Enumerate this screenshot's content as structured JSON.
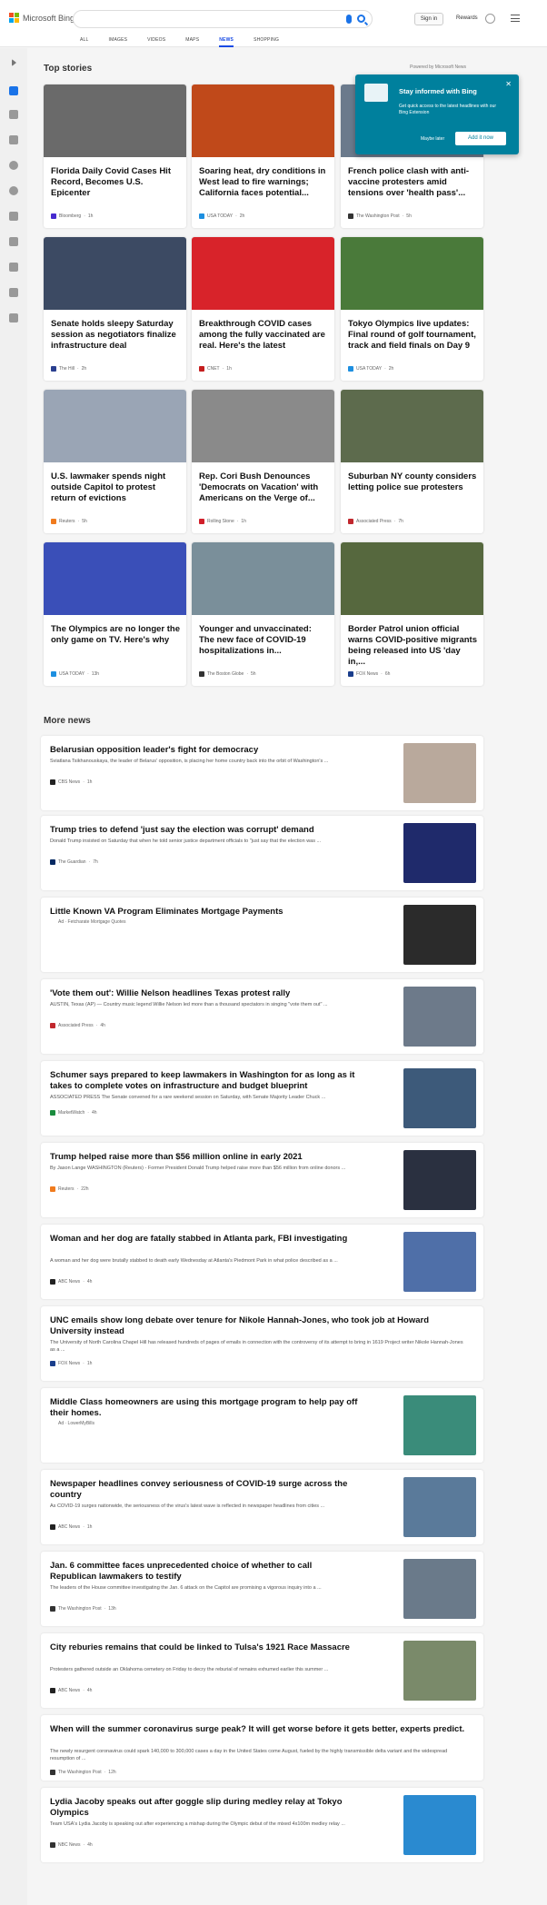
{
  "brand": {
    "name": "Microsoft Bing"
  },
  "header": {
    "signin_label": "Sign in",
    "rewards_label": "Rewards"
  },
  "nav": {
    "tabs": [
      "ALL",
      "IMAGES",
      "VIDEOS",
      "MAPS",
      "NEWS",
      "SHOPPING"
    ],
    "active": "NEWS"
  },
  "section": {
    "top_stories": "Top stories",
    "powered": "Powered by Microsoft News",
    "more_news": "More news"
  },
  "popup": {
    "heading": "Stay informed with Bing",
    "body": "Get quick access to the latest headlines with our Bing Extension",
    "later": "Maybe later",
    "add": "Add it now"
  },
  "top_stories": [
    {
      "title": "Florida Daily Covid Cases Hit Record, Becomes U.S. Epicenter",
      "source": "Bloomberg",
      "time": "1h",
      "color": "#6a6a6a",
      "icon_color": "#472bcf"
    },
    {
      "title": "Soaring heat, dry conditions in West lead to fire warnings; California faces potential...",
      "source": "USA TODAY",
      "time": "2h",
      "color": "#c0491a",
      "icon_color": "#1d8fe0"
    },
    {
      "title": "French police clash with anti-vaccine protesters amid tensions over 'health pass'...",
      "source": "The Washington Post",
      "time": "5h",
      "color": "#6b7a8c",
      "icon_color": "#333333"
    },
    {
      "title": "Senate holds sleepy Saturday session as negotiators finalize infrastructure deal",
      "source": "The Hill",
      "time": "2h",
      "color": "#3c4a63",
      "icon_color": "#2a3f8f"
    },
    {
      "title": "Breakthrough COVID cases among the fully vaccinated are real. Here's the latest",
      "source": "CNET",
      "time": "1h",
      "color": "#d8232a",
      "icon_color": "#c41e1e"
    },
    {
      "title": "Tokyo Olympics live updates: Final round of golf tournament, track and field finals on Day 9",
      "source": "USA TODAY",
      "time": "2h",
      "color": "#4a7a3a",
      "icon_color": "#1d8fe0"
    },
    {
      "title": "U.S. lawmaker spends night outside Capitol to protest return of evictions",
      "source": "Reuters",
      "time": "5h",
      "color": "#9aa5b5",
      "icon_color": "#f07b1e"
    },
    {
      "title": "Rep. Cori Bush Denounces 'Democrats on Vacation' with Americans on the Verge of...",
      "source": "Rolling Stone",
      "time": "1h",
      "color": "#8a8a8a",
      "icon_color": "#d11f2a"
    },
    {
      "title": "Suburban NY county considers letting police sue protesters",
      "source": "Associated Press",
      "time": "7h",
      "color": "#5d6b4d",
      "icon_color": "#c1272d"
    },
    {
      "title": "The Olympics are no longer the only game on TV. Here's why",
      "source": "USA TODAY",
      "time": "13h",
      "color": "#3a4fb8",
      "icon_color": "#1d8fe0"
    },
    {
      "title": "Younger and unvaccinated: The new face of COVID-19 hospitalizations in...",
      "source": "The Boston Globe",
      "time": "5h",
      "color": "#7a8f9a",
      "icon_color": "#333333"
    },
    {
      "title": "Border Patrol union official warns COVID-positive migrants being released into US 'day in,...",
      "source": "FOX News",
      "time": "6h",
      "color": "#56683e",
      "icon_color": "#1a3e8c"
    }
  ],
  "more_news": [
    {
      "title": "Belarusian opposition leader's fight for democracy",
      "desc": "Sviatlana Tsikhanouskaya, the leader of Belarus' opposition, is placing her home country back into the orbit of Washington's ...",
      "source": "CBS News",
      "time": "1h",
      "color": "#b9a99c",
      "icon_color": "#222222"
    },
    {
      "title": "Trump tries to defend 'just say the election was corrupt' demand",
      "desc": "Donald Trump insisted on Saturday that when he told senior justice department officials to \"just say that the election was ...",
      "source": "The Guardian",
      "time": "7h",
      "color": "#1f2a6b",
      "icon_color": "#052962"
    },
    {
      "title": "Little Known VA Program Eliminates Mortgage Payments",
      "desc": "",
      "source": "Ad · Fetcharate Mortgage Quotes",
      "time": "",
      "color": "#2b2b2b",
      "icon_color": "#ffffff"
    },
    {
      "title": "'Vote them out': Willie Nelson headlines Texas protest rally",
      "desc": "AUSTIN, Texas (AP) — Country music legend Willie Nelson led more than a thousand spectators in singing \"vote them out\" ...",
      "source": "Associated Press",
      "time": "4h",
      "color": "#6d7a8a",
      "icon_color": "#c1272d"
    },
    {
      "title": "Schumer says prepared to keep lawmakers in Washington for as long as it takes to complete votes on infrastructure and budget blueprint",
      "desc": "ASSOCIATED PRESS The Senate convened for a rare weekend session on Saturday, with Senate Majority Leader Chuck ...",
      "source": "MarketWatch",
      "time": "4h",
      "color": "#3d5a7a",
      "icon_color": "#1a8c3e"
    },
    {
      "title": "Trump helped raise more than $56 million online in early 2021",
      "desc": "By Jason Lange WASHINGTON (Reuters) - Former President Donald Trump helped raise more than $56 million from online donors ...",
      "source": "Reuters",
      "time": "22h",
      "color": "#2a3040",
      "icon_color": "#f07b1e"
    },
    {
      "title": "Woman and her dog are fatally stabbed in Atlanta park, FBI investigating",
      "desc": "A woman and her dog were brutally stabbed to death early Wednesday at Atlanta's Piedmont Park in what police described as a ...",
      "source": "ABC News",
      "time": "4h",
      "color": "#4f6fa8",
      "icon_color": "#222222"
    },
    {
      "title": "UNC emails show long debate over tenure for Nikole Hannah-Jones, who took job at Howard University instead",
      "desc": "The University of North Carolina Chapel Hill has released hundreds of pages of emails in connection with the controversy of its attempt to bring in 1619 Project writer Nikole Hannah-Jones as a ...",
      "source": "FOX News",
      "time": "1h",
      "color": "",
      "icon_color": "#1a3e8c"
    },
    {
      "title": "Middle Class homeowners are using this mortgage program to help pay off their homes.",
      "desc": "",
      "source": "Ad · LowerMyBills",
      "time": "",
      "color": "#3a8c7a",
      "icon_color": "#ffffff"
    },
    {
      "title": "Newspaper headlines convey seriousness of COVID-19 surge across the country",
      "desc": "As COVID-19 surges nationwide, the seriousness of the virus's latest wave is reflected in newspaper headlines from cities ...",
      "source": "ABC News",
      "time": "1h",
      "color": "#5a7a9a",
      "icon_color": "#222222"
    },
    {
      "title": "Jan. 6 committee faces unprecedented choice of whether to call Republican lawmakers to testify",
      "desc": "The leaders of the House committee investigating the Jan. 6 attack on the Capitol are promising a vigorous inquiry into a ...",
      "source": "The Washington Post",
      "time": "13h",
      "color": "#6a7a8a",
      "icon_color": "#333333"
    },
    {
      "title": "City reburies remains that could be linked to Tulsa's 1921 Race Massacre",
      "desc": "Protesters gathered outside an Oklahoma cemetery on Friday to decry the reburial of remains exhumed earlier this summer ...",
      "source": "ABC News",
      "time": "4h",
      "color": "#7a8a6a",
      "icon_color": "#222222"
    },
    {
      "title": "When will the summer coronavirus surge peak? It will get worse before it gets better, experts predict.",
      "desc": "The newly resurgent coronavirus could spark 140,000 to 300,000 cases a day in the United States come August, fueled by the highly transmissible delta variant and the widespread resumption of ...",
      "source": "The Washington Post",
      "time": "12h",
      "color": "",
      "icon_color": "#333333"
    },
    {
      "title": "Lydia Jacoby speaks out after goggle slip during medley relay at Tokyo Olympics",
      "desc": "Team USA's Lydia Jacoby is speaking out after experiencing a mishap during the Olympic debut of the mixed 4x100m medley relay ...",
      "source": "NBC News",
      "time": "4h",
      "color": "#2a8ad0",
      "icon_color": "#333333"
    }
  ]
}
